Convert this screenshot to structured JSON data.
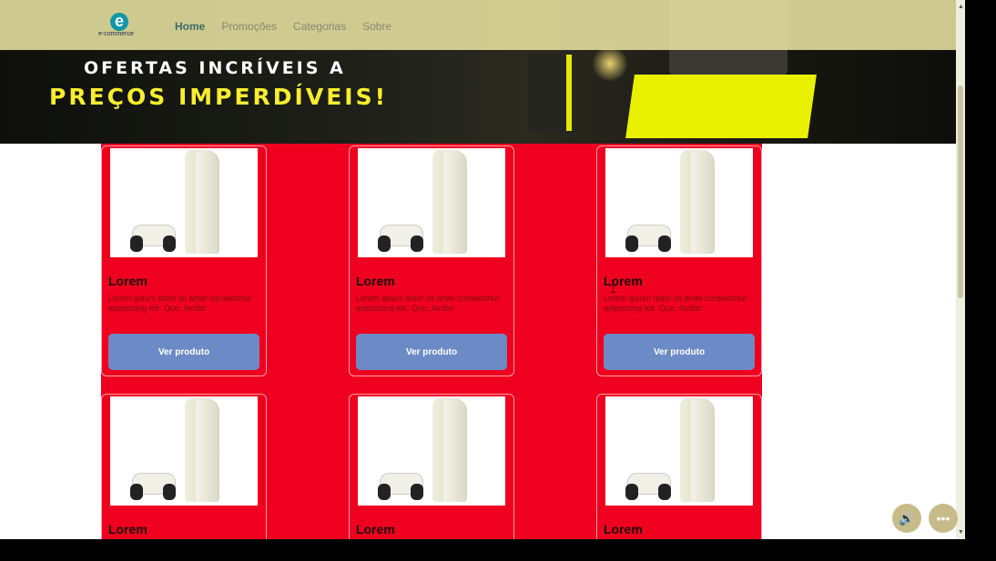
{
  "hero": {
    "line1": "OFERTAS INCRÍVEIS A",
    "line2": "PREÇOS IMPERDÍVEIS!"
  },
  "logo": {
    "mark": "e",
    "text": "e-commerce"
  },
  "nav": {
    "items": [
      {
        "label": "Home",
        "active": true
      },
      {
        "label": "Promoções",
        "active": false
      },
      {
        "label": "Categorias",
        "active": false
      },
      {
        "label": "Sobre",
        "active": false
      }
    ]
  },
  "products": [
    {
      "title": "Lorem",
      "desc": "Lorem ipsum dolor sit amet consectetur adipisicing elit. Quo, facilis!",
      "button": "Ver produto"
    },
    {
      "title": "Lorem",
      "desc": "Lorem ipsum dolor sit amet consectetur adipisicing elit. Quo, facilis!",
      "button": "Ver produto"
    },
    {
      "title": "Lorem",
      "desc": "Lorem ipsum dolor sit amet consectetur adipisicing elit. Quo, facilis!",
      "button": "Ver produto"
    },
    {
      "title": "Lorem",
      "desc": "",
      "button": ""
    },
    {
      "title": "Lorem",
      "desc": "",
      "button": ""
    },
    {
      "title": "Lorem",
      "desc": "",
      "button": ""
    }
  ],
  "controls": {
    "volume_icon": "speaker-icon",
    "more_icon": "more-icon"
  },
  "colors": {
    "accent_red": "#ef0020",
    "button_blue": "#6c8bc6",
    "navbar": "#e8e2a0"
  }
}
